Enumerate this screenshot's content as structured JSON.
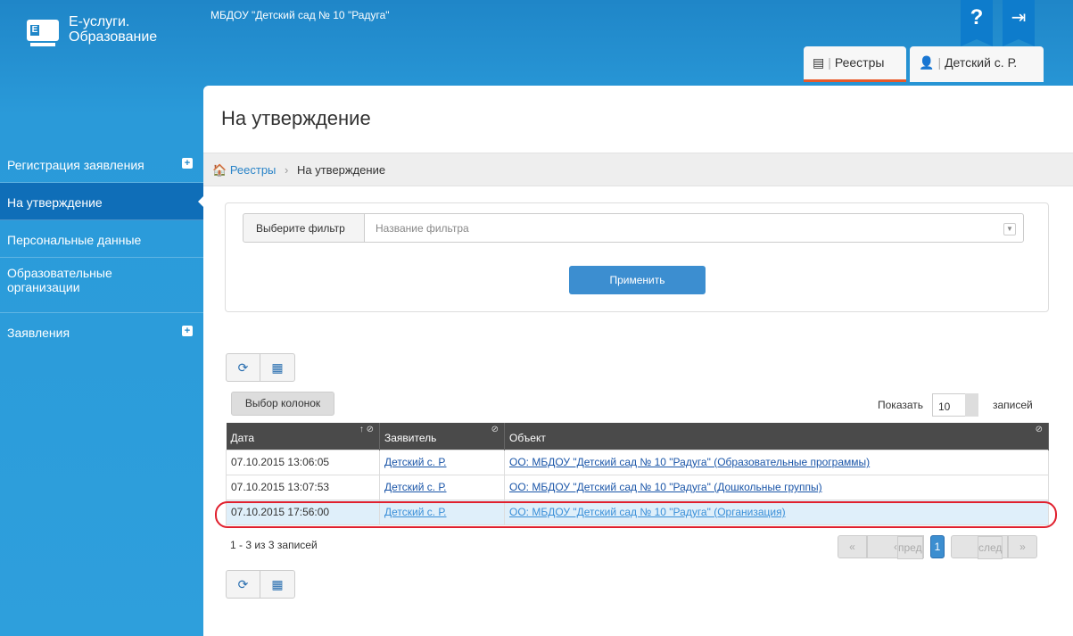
{
  "header": {
    "brand_line1": "Е-услуги.",
    "brand_line2": "Образование",
    "org_name": "МБДОУ \"Детский сад № 10 \"Радуга\"",
    "help_icon": "?",
    "exit_icon": "⇥"
  },
  "tabs": [
    {
      "label": "Реестры",
      "icon": "registry-icon"
    },
    {
      "label": "Детский с. Р.",
      "icon": "user-icon"
    }
  ],
  "sidebar": {
    "items": [
      {
        "label": "Регистрация заявления",
        "expandable": true
      },
      {
        "label": "На утверждение",
        "active": true
      },
      {
        "label": "Персональные данные"
      },
      {
        "label": "Образовательные организации"
      },
      {
        "label": "Заявления",
        "expandable": true
      }
    ]
  },
  "page": {
    "title": "На утверждение",
    "breadcrumb_root": "Реестры",
    "breadcrumb_current": "На утверждение"
  },
  "filter": {
    "label": "Выберите фильтр",
    "placeholder": "Название фильтра",
    "apply_label": "Применить"
  },
  "toolbar": {
    "columns_label": "Выбор колонок",
    "show_label": "Показать",
    "show_value": "10",
    "records_label": "записей"
  },
  "table": {
    "headers": [
      "Дата",
      "Заявитель",
      "Объект"
    ],
    "rows": [
      {
        "date": "07.10.2015 13:06:05",
        "applicant": "Детский с. Р.",
        "object": "ОО: МБДОУ \"Детский сад № 10 \"Радуга\" (Образовательные программы)"
      },
      {
        "date": "07.10.2015 13:07:53",
        "applicant": "Детский с. Р.",
        "object": "ОО: МБДОУ \"Детский сад № 10 \"Радуга\" (Дошкольные группы)"
      },
      {
        "date": "07.10.2015 17:56:00",
        "applicant": "Детский с. Р.",
        "object": "ОО: МБДОУ \"Детский сад № 10 \"Радуга\" (Организация)"
      }
    ]
  },
  "pagination": {
    "summary": "1 - 3 из 3 записей",
    "prev": "пред",
    "next": "след",
    "current": "1"
  }
}
